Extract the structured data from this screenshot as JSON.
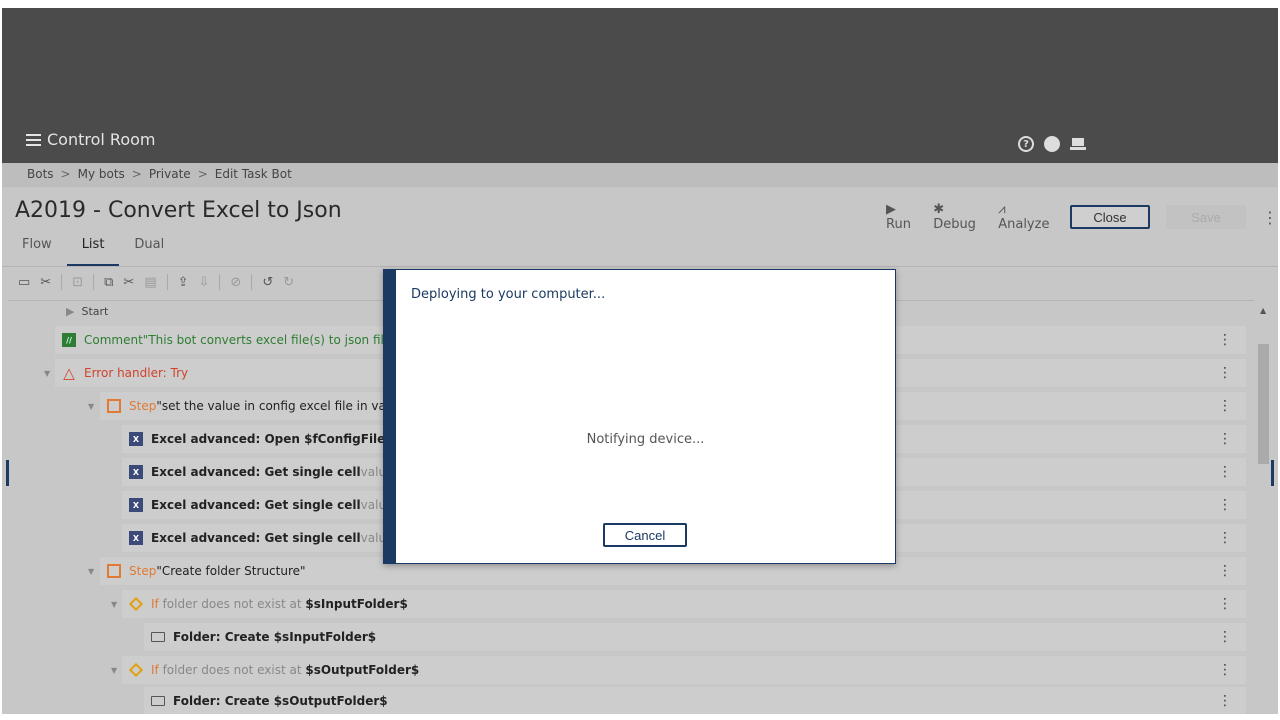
{
  "header": {
    "app_title": "Control Room",
    "icons": [
      "help-icon",
      "globe-icon",
      "laptop-icon"
    ]
  },
  "breadcrumb": [
    "Bots",
    "My bots",
    "Private",
    "Edit Task Bot"
  ],
  "breadcrumb_sep": ">",
  "page_title": "A2019 - Convert Excel to Json",
  "actions": {
    "run": "Run",
    "debug": "Debug",
    "analyze": "Analyze",
    "close": "Close",
    "save": "Save"
  },
  "tabs": [
    {
      "label": "Flow"
    },
    {
      "label": "List",
      "active": true
    },
    {
      "label": "Dual"
    }
  ],
  "list": {
    "start": "Start",
    "rows": [
      {
        "n": "1",
        "kw": "Comment",
        "text": " \"This bot converts excel file(s) to json file(s"
      },
      {
        "n": "2",
        "kw": "Error handler: Try"
      },
      {
        "n": "3",
        "kw": "Step",
        "text": " \"set the value in config excel file in varia"
      },
      {
        "n": "4",
        "bold": "Excel advanced: Open $fConfigFile$"
      },
      {
        "n": "5",
        "bold": "Excel advanced: Get single cell",
        "muted": " value of S"
      },
      {
        "n": "6",
        "bold": "Excel advanced: Get single cell",
        "muted": " value of S"
      },
      {
        "n": "7",
        "bold": "Excel advanced: Get single cell",
        "muted": " value of S"
      },
      {
        "n": "8",
        "kw": "Step",
        "text": " \"Create folder Structure\""
      },
      {
        "n": "9",
        "kw": "If",
        "muted": " folder does not exist at ",
        "bold": "$sInputFolder$"
      },
      {
        "n": "10",
        "bold": "Folder: Create $sInputFolder$"
      },
      {
        "n": "11",
        "kw": "If",
        "muted": " folder does not exist at ",
        "bold": "$sOutputFolder$"
      },
      {
        "n": "12",
        "bold": "Folder: Create $sOutputFolder$"
      }
    ]
  },
  "dialog": {
    "title": "Deploying to your computer...",
    "message": "Notifying device...",
    "cancel": "Cancel"
  }
}
